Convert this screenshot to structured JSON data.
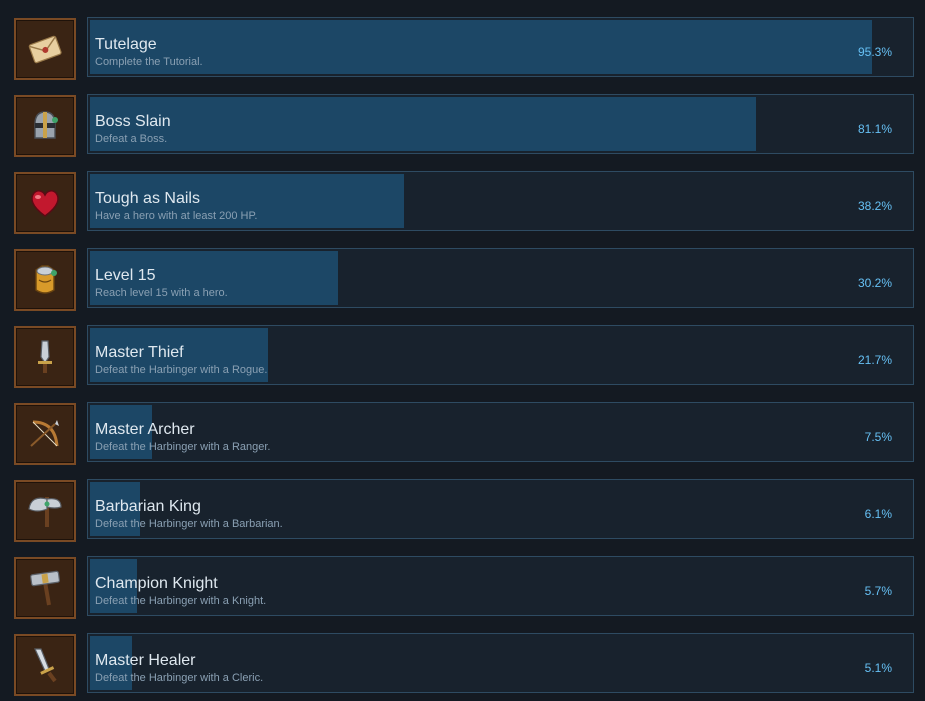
{
  "colors": {
    "bar_fill": "#1c4766",
    "percent_text": "#66c0f4",
    "frame": "#7a4a24"
  },
  "achievements": [
    {
      "title": "Tutelage",
      "description": "Complete the Tutorial.",
      "percent_label": "95.3%",
      "percent": 95.3,
      "icon": "envelope-icon"
    },
    {
      "title": "Boss Slain",
      "description": "Defeat a Boss.",
      "percent_label": "81.1%",
      "percent": 81.1,
      "icon": "helmet-icon"
    },
    {
      "title": "Tough as Nails",
      "description": "Have a hero with at least 200 HP.",
      "percent_label": "38.2%",
      "percent": 38.2,
      "icon": "heart-icon"
    },
    {
      "title": "Level 15",
      "description": "Reach level 15 with a hero.",
      "percent_label": "30.2%",
      "percent": 30.2,
      "icon": "armor-icon"
    },
    {
      "title": "Master Thief",
      "description": "Defeat the Harbinger with a Rogue.",
      "percent_label": "21.7%",
      "percent": 21.7,
      "icon": "dagger-icon"
    },
    {
      "title": "Master Archer",
      "description": "Defeat the Harbinger with a Ranger.",
      "percent_label": "7.5%",
      "percent": 7.5,
      "icon": "bow-icon"
    },
    {
      "title": "Barbarian King",
      "description": "Defeat the Harbinger with a Barbarian.",
      "percent_label": "6.1%",
      "percent": 6.1,
      "icon": "axe-icon"
    },
    {
      "title": "Champion Knight",
      "description": "Defeat the Harbinger with a Knight.",
      "percent_label": "5.7%",
      "percent": 5.7,
      "icon": "hammer-icon"
    },
    {
      "title": "Master Healer",
      "description": "Defeat the Harbinger with a Cleric.",
      "percent_label": "5.1%",
      "percent": 5.1,
      "icon": "sword-icon"
    }
  ]
}
